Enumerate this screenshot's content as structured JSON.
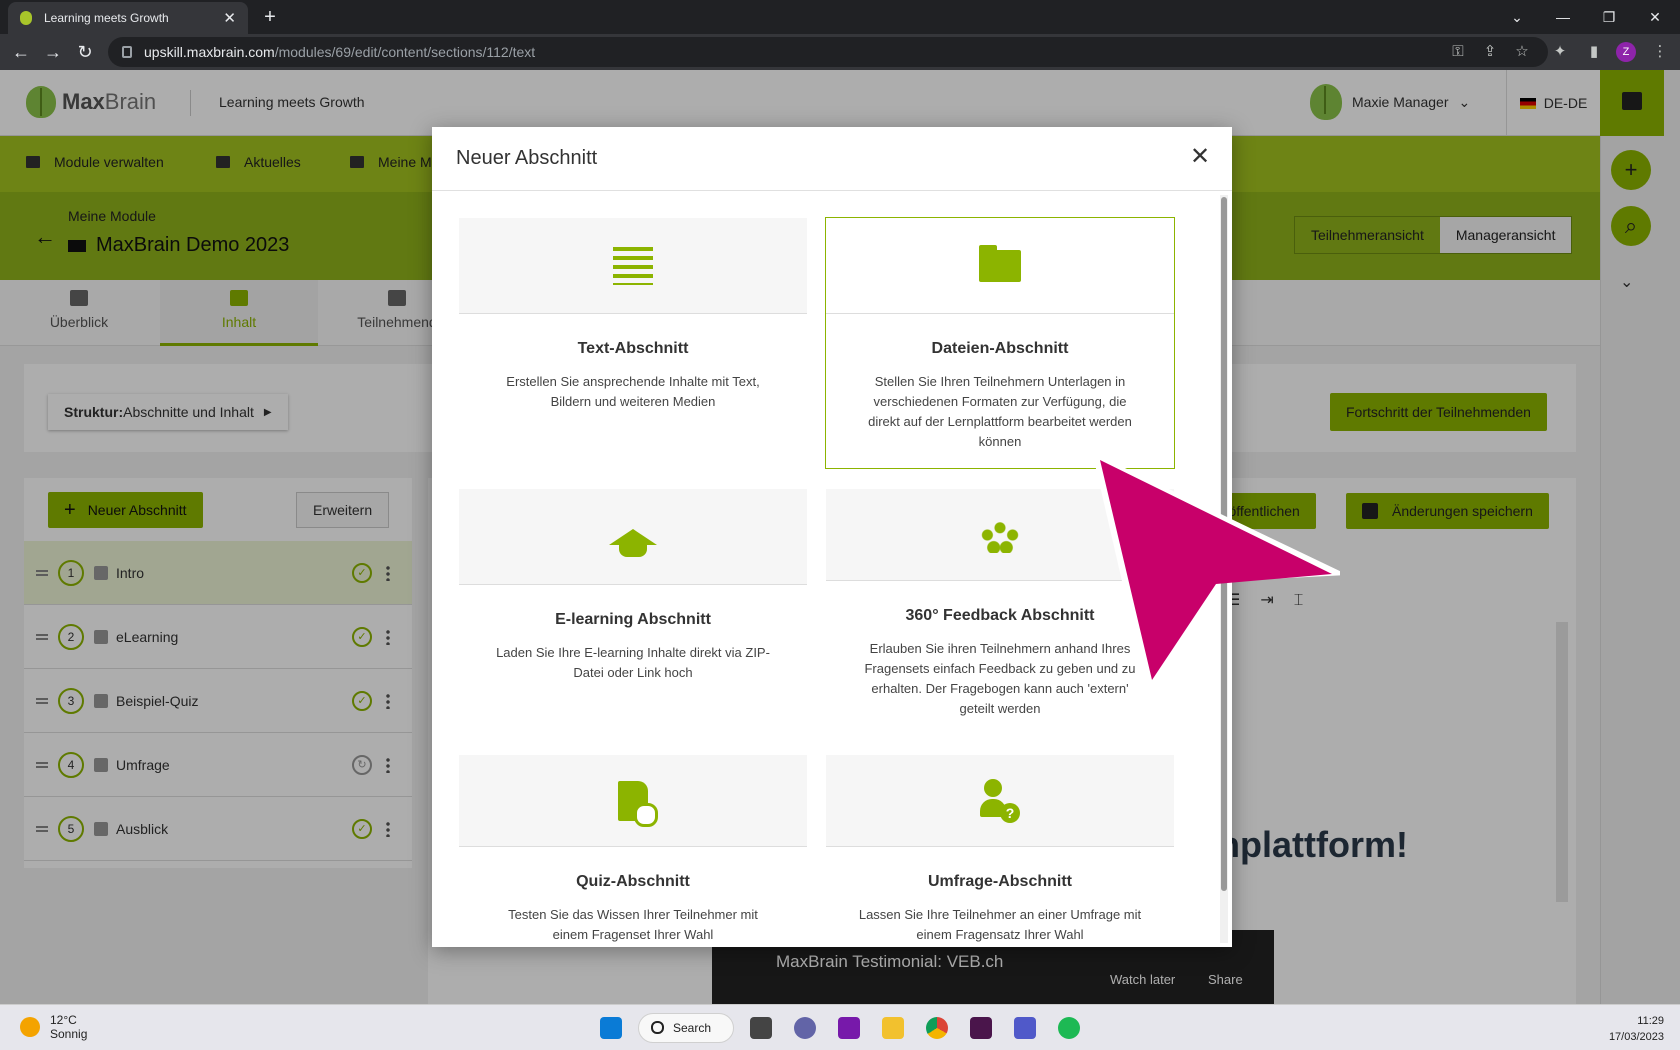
{
  "browser": {
    "tab_title": "Learning meets Growth",
    "url_host": "upskill.maxbrain.com",
    "url_path": "/modules/69/edit/content/sections/112/text",
    "profile_initial": "Z"
  },
  "header": {
    "brand_max": "Max",
    "brand_brain": "Brain",
    "tagline": "Learning meets Growth",
    "user_name": "Maxie Manager",
    "language": "DE-DE"
  },
  "nav": {
    "items": [
      "Module verwalten",
      "Aktuelles",
      "Meine M"
    ]
  },
  "module": {
    "breadcrumb": "Meine Module",
    "title": "MaxBrain Demo 2023",
    "view_participant": "Teilnehmeransicht",
    "view_manager": "Manageransicht"
  },
  "tabs": [
    "Überblick",
    "Inhalt",
    "Teilnehmend"
  ],
  "structure": {
    "label_bold": "Struktur:",
    "label": " Abschnitte und Inhalt",
    "progress_button": "Fortschritt der Teilnehmenden"
  },
  "sections_panel": {
    "new_button": "Neuer Abschnitt",
    "expand_button": "Erweitern",
    "rows": [
      {
        "num": "1",
        "name": "Intro",
        "status": "done"
      },
      {
        "num": "2",
        "name": "eLearning",
        "status": "done"
      },
      {
        "num": "3",
        "name": "Beispiel-Quiz",
        "status": "done"
      },
      {
        "num": "4",
        "name": "Umfrage",
        "status": "sync"
      },
      {
        "num": "5",
        "name": "Ausblick",
        "status": "done"
      }
    ]
  },
  "editor": {
    "publish_button": "eröffentlichen",
    "save_button": "Änderungen speichern",
    "visible_text": "nplattform!",
    "video_title": "MaxBrain Testimonial: VEB.ch",
    "video_watch_later": "Watch later",
    "video_share": "Share"
  },
  "modal": {
    "title": "Neuer Abschnitt",
    "cards": [
      {
        "icon": "text-lines-icon",
        "title": "Text-Abschnitt",
        "description": "Erstellen Sie ansprechende Inhalte mit Text, Bildern und weiteren Medien"
      },
      {
        "icon": "folder-icon",
        "title": "Dateien-Abschnitt",
        "description": "Stellen Sie Ihren Teilnehmern Unterlagen in verschiedenen Formaten zur Verfügung, die direkt auf der Lernplattform bearbeitet werden können"
      },
      {
        "icon": "graduation-cap-icon",
        "title": "E-learning Abschnitt",
        "description": "Laden Sie Ihre E-learning Inhalte direkt via ZIP-Datei oder Link hoch"
      },
      {
        "icon": "people-group-icon",
        "title": "360° Feedback Abschnitt",
        "description": "Erlauben Sie ihren Teilnehmern anhand Ihres Fragensets einfach Feedback zu geben und zu erhalten. Der Fragebogen kann auch 'extern' geteilt werden"
      },
      {
        "icon": "quiz-document-icon",
        "title": "Quiz-Abschnitt",
        "description": "Testen Sie das Wissen Ihrer Teilnehmer mit einem Fragenset Ihrer Wahl"
      },
      {
        "icon": "survey-person-icon",
        "title": "Umfrage-Abschnitt",
        "description": "Lassen Sie Ihre Teilnehmer an einer Umfrage mit einem Fragensatz Ihrer Wahl"
      }
    ]
  },
  "taskbar": {
    "temperature": "12°C",
    "weather": "Sonnig",
    "search": "Search",
    "time": "11:29",
    "date": "17/03/2023"
  },
  "colors": {
    "brand_green": "#8cb400",
    "nav_green": "#a2c31f",
    "pointer_magenta": "#c8006a"
  }
}
